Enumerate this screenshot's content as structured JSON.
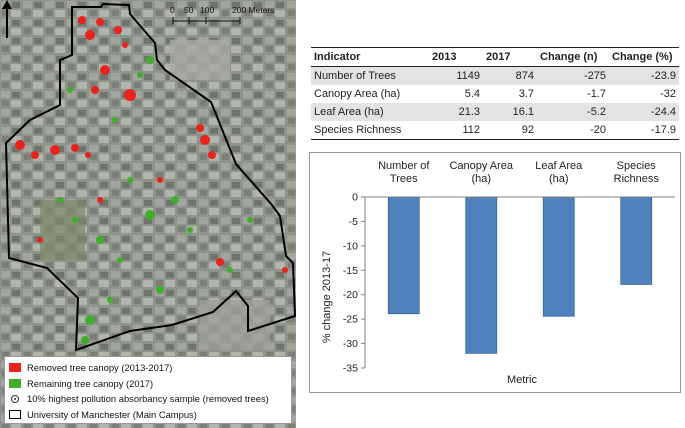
{
  "map": {
    "scale_labels": [
      "0",
      "50",
      "100",
      "200 Meters"
    ],
    "legend": [
      {
        "label": "Removed tree canopy (2013-2017)",
        "color": "#e8231c",
        "symbol": "red-square"
      },
      {
        "label": "Remaining tree canopy (2017)",
        "color": "#3fae2a",
        "symbol": "green-square"
      },
      {
        "label": "10% highest pollution absorbancy sample (removed trees)",
        "symbol": "dot-circle"
      },
      {
        "label": "University of Manchester (Main Campus)",
        "symbol": "outline-box"
      }
    ]
  },
  "table": {
    "headers": [
      "Indicator",
      "2013",
      "2017",
      "Change (n)",
      "Change (%)"
    ],
    "rows": [
      [
        "Number of Trees",
        "1149",
        "874",
        "-275",
        "-23.9"
      ],
      [
        "Canopy Area (ha)",
        "5.4",
        "3.7",
        "-1.7",
        "-32"
      ],
      [
        "Leaf Area (ha)",
        "21.3",
        "16.1",
        "-5.2",
        "-24.4"
      ],
      [
        "Species Richness",
        "112",
        "92",
        "-20",
        "-17.9"
      ]
    ]
  },
  "chart_data": {
    "type": "bar",
    "categories": [
      "Number of Trees",
      "Canopy Area (ha)",
      "Leaf Area (ha)",
      "Species Richness"
    ],
    "category_label_lines": [
      [
        "Number of",
        "Trees"
      ],
      [
        "Canopy Area",
        "(ha)"
      ],
      [
        "Leaf Area",
        "(ha)"
      ],
      [
        "Species",
        "Richness"
      ]
    ],
    "values": [
      -23.9,
      -32,
      -24.4,
      -17.9
    ],
    "xlabel": "Metric",
    "ylabel": "% change 2013-17",
    "ylim": [
      -35,
      0
    ],
    "yticks": [
      0,
      -5,
      -10,
      -15,
      -20,
      -25,
      -30,
      -35
    ],
    "category_axis_position": "top",
    "bar_color": "#4f81bd",
    "grid": false,
    "legend": "none"
  }
}
